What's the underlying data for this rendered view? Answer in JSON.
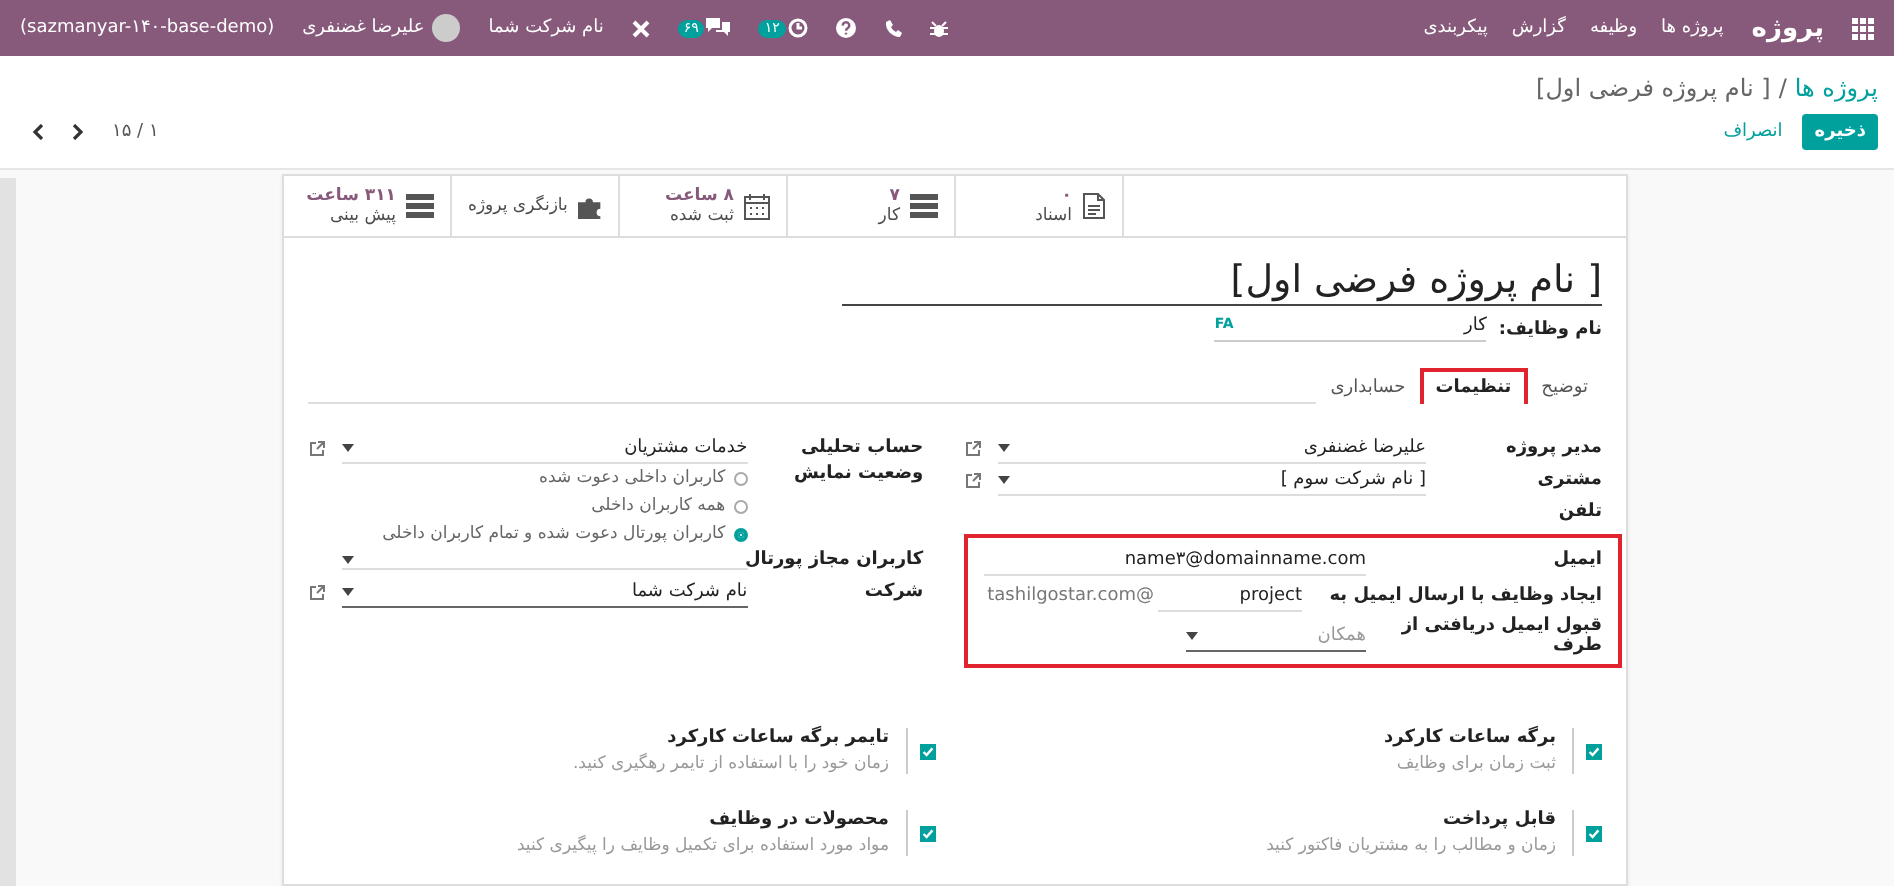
{
  "navbar": {
    "app_name": "پروژه",
    "menu": [
      {
        "label": "پروژه ها"
      },
      {
        "label": "وظیفه"
      },
      {
        "label": "گزارش"
      },
      {
        "label": "پیکربندی"
      }
    ],
    "company": "نام شرکت شما",
    "user": "علیرضا غضنفری",
    "database": "(sazmanyar-۱۴۰-base-demo)",
    "chat_count": "۶۹",
    "activity_count": "۱۲"
  },
  "breadcrumb": {
    "parent": "پروژه ها",
    "separator": "/",
    "current": "[ نام پروژه فرضی اول]"
  },
  "actions": {
    "save": "ذخیره",
    "discard": "انصراف"
  },
  "pager": {
    "value": "۱ / ۱۵"
  },
  "stat_buttons": [
    {
      "kind": "documents",
      "value": "۰",
      "label": "اسناد"
    },
    {
      "kind": "tasks",
      "value": "۷",
      "label": "کار"
    },
    {
      "kind": "timesheets",
      "value": "۸ ساعت",
      "label": "ثبت شده"
    },
    {
      "kind": "review",
      "label": "بازنگری پروژه"
    },
    {
      "kind": "forecast",
      "value": "۳۱۱ ساعت",
      "label": "پیش بینی"
    }
  ],
  "title": "[ نام پروژه فرضی اول]",
  "task_label": {
    "label": "نام وظایف:",
    "value": "کار",
    "language": "FA"
  },
  "tabs": [
    {
      "label": "توضیح",
      "selected": false
    },
    {
      "label": "تنظیمات",
      "selected": true
    },
    {
      "label": "حسابداری",
      "selected": false
    }
  ],
  "right_fields": [
    {
      "kind": "many2one",
      "label": "مدیر پروژه",
      "value": "علیرضا غضنفری"
    },
    {
      "kind": "many2one",
      "label": "مشتری",
      "value": "[ نام شرکت سوم ]"
    },
    {
      "kind": "empty",
      "label": "تلفن"
    }
  ],
  "email_box": {
    "email": {
      "label": "ایمیل",
      "value": "name۳@domainname.com"
    },
    "alias": {
      "label": "ایجاد وظایف با ارسال ایمیل به",
      "value": "project",
      "domain": "@tashilgostar.com"
    },
    "accept_from": {
      "label": "قبول ایمیل دریافتی از طرف",
      "placeholder": "همکان"
    }
  },
  "left_fields": [
    {
      "kind": "many2one",
      "label": "حساب تحلیلی",
      "value": "خدمات مشتریان"
    },
    {
      "kind": "radio",
      "label": "وضعیت نمایش",
      "options": [
        {
          "label": "کاربران داخلی دعوت شده",
          "selected": false
        },
        {
          "label": "همه کاربران داخلی",
          "selected": false
        },
        {
          "label": "کاربران پورتال دعوت شده و تمام کاربران داخلی",
          "selected": true
        }
      ]
    },
    {
      "kind": "tags",
      "label": "کاربران مجاز پورتال"
    },
    {
      "kind": "company",
      "label": "شرکت",
      "value": "نام شرکت شما"
    }
  ],
  "settings": [
    {
      "title": "برگه ساعات کارکرد",
      "description": "ثبت زمان برای وظایف",
      "checked": true
    },
    {
      "title": "تایمر برگه ساعات کارکرد",
      "description": "زمان خود را با استفاده از تایمر رهگیری کنید.",
      "checked": true
    },
    {
      "title": "قابل پرداخت",
      "description": "زمان و مطالب را به مشتریان فاکتور کنید",
      "checked": true
    },
    {
      "title": "محصولات در وظایف",
      "description": "مواد مورد استفاده برای تکمیل وظایف را پیگیری کنید",
      "checked": true
    }
  ]
}
